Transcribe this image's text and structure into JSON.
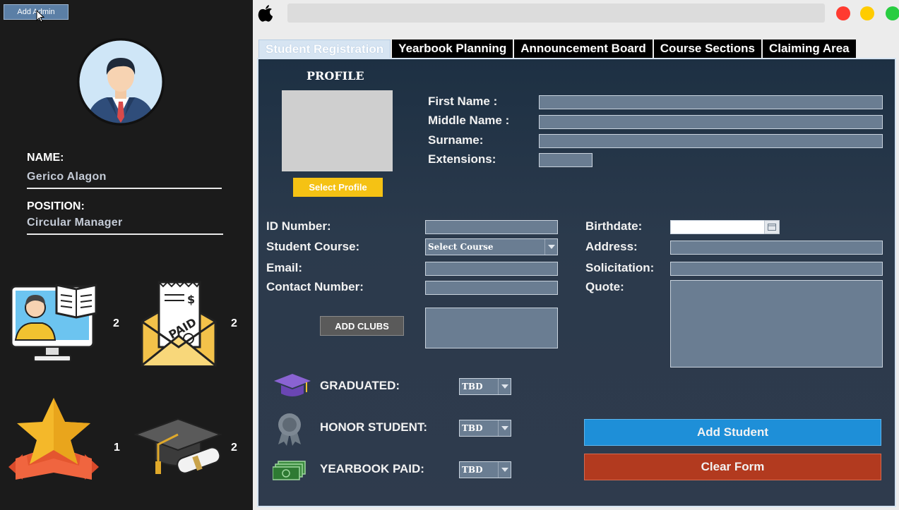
{
  "sidebar": {
    "add_admin_label": "Add Admin",
    "name_label": "NAME:",
    "name_value": "Gerico Alagon",
    "position_label": "POSITION:",
    "position_value": "Circular Manager",
    "stats": [
      {
        "icon": "student-computer-icon",
        "count": "2"
      },
      {
        "icon": "paid-envelope-icon",
        "count": "2"
      },
      {
        "icon": "star-award-icon",
        "count": "1"
      },
      {
        "icon": "graduation-cap-diploma-icon",
        "count": "2"
      }
    ]
  },
  "window": {
    "tabs": [
      "Student Registration",
      "Yearbook Planning",
      "Announcement Board",
      "Course Sections",
      "Claiming Area"
    ],
    "active_tab": 0,
    "traffic_colors": [
      "#ff3b30",
      "#ffcc00",
      "#28cd41"
    ]
  },
  "form": {
    "profile_title": "PROFILE",
    "select_profile_label": "Select Profile",
    "first_name_label": "First Name     :",
    "middle_name_label": "Middle Name :",
    "surname_label": "Surname:",
    "extensions_label": "Extensions:",
    "id_number_label": "ID Number:",
    "student_course_label": "Student Course:",
    "course_selected": "Select Course",
    "email_label": "Email:",
    "contact_label": "Contact Number:",
    "add_clubs_label": "ADD CLUBS",
    "birthdate_label": "Birthdate:",
    "address_label": "Address:",
    "solicitation_label": "Solicitation:",
    "quote_label": "Quote:",
    "graduated_label": "GRADUATED:",
    "graduated_value": "TBD",
    "honor_label": "HONOR STUDENT:",
    "honor_value": "TBD",
    "yearbook_label": "YEARBOOK PAID:",
    "yearbook_value": "TBD",
    "add_student_label": "Add Student",
    "clear_form_label": "Clear Form"
  },
  "colors": {
    "panel_bg": "#2b3a4c",
    "field_bg": "#6a7d92",
    "add_student_bg": "#1e8fd8",
    "clear_form_bg": "#b23a1f",
    "select_profile_bg": "#f5c214"
  }
}
